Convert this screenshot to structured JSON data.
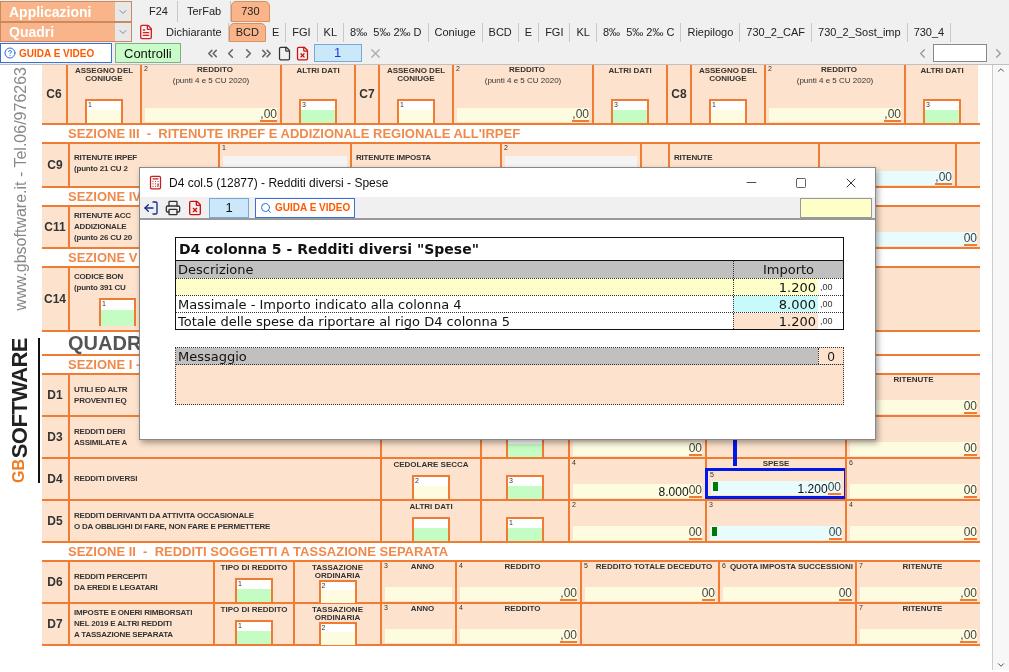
{
  "app_menu": {
    "label": "Applicazioni"
  },
  "section_menu": {
    "label": "Quadri"
  },
  "app_tabs": [
    {
      "label": "F24",
      "selected": false
    },
    {
      "label": "TerFab",
      "selected": false
    },
    {
      "label": "730",
      "selected": true
    }
  ],
  "quadri_tabs": [
    {
      "label": "Dichiarante",
      "selected": false
    },
    {
      "label": "BCD",
      "selected": true
    },
    {
      "label": "E",
      "selected": false
    },
    {
      "label": "FGI",
      "selected": false
    },
    {
      "label": "KL",
      "selected": false
    },
    {
      "label": "8‰  5‰ 2‰ D",
      "selected": false
    },
    {
      "label": "Coniuge",
      "selected": false
    },
    {
      "label": "BCD",
      "selected": false
    },
    {
      "label": "E",
      "selected": false
    },
    {
      "label": "FGI",
      "selected": false
    },
    {
      "label": "KL",
      "selected": false
    },
    {
      "label": "8‰  5‰ 2‰ C",
      "selected": false
    },
    {
      "label": "Riepilogo",
      "selected": false
    },
    {
      "label": "730_2_CAF",
      "selected": false
    },
    {
      "label": "730_2_Sost_imp",
      "selected": false
    },
    {
      "label": "730_4",
      "selected": false
    }
  ],
  "toolbar": {
    "help_button": "GUIDA E VIDEO",
    "controls_button": "Controlli",
    "page": "1"
  },
  "sidebar": {
    "website": "www.gbsoftware.it - Tel.06/976263",
    "logo_mark": "GB",
    "logo": "SOFTWARE"
  },
  "form": [
    {
      "kind": "c_groups",
      "groups": [
        {
          "code": "C6",
          "cells": [
            {
              "kind": "box",
              "num": "1",
              "label": "ASSEGNO DEL CONIUGE",
              "color": "#fdfbe0"
            },
            {
              "kind": "field",
              "num": "2",
              "label": "REDDITO",
              "sub": "(punti 4 e 5 CU 2020)",
              "cents": ",00",
              "color": "#fdfbe0"
            },
            {
              "kind": "box",
              "num": "3",
              "label": "ALTRI DATI",
              "color": "#c4fcc4"
            }
          ]
        },
        {
          "code": "C7",
          "cells": [
            {
              "kind": "box",
              "num": "1",
              "label": "ASSEGNO DEL CONIUGE",
              "color": "#fdfbe0"
            },
            {
              "kind": "field",
              "num": "2",
              "label": "REDDITO",
              "sub": "(punti 4 e 5 CU 2020)",
              "cents": ",00",
              "color": "#fdfbe0"
            },
            {
              "kind": "box",
              "num": "3",
              "label": "ALTRI DATI",
              "color": "#c4fcc4"
            }
          ]
        },
        {
          "code": "C8",
          "cells": [
            {
              "kind": "box",
              "num": "1",
              "label": "ASSEGNO DEL CONIUGE",
              "color": "#fdfbe0"
            },
            {
              "kind": "field",
              "num": "2",
              "label": "REDDITO",
              "sub": "(punti 4 e 5 CU 2020)",
              "cents": ",00",
              "color": "#fdfbe0"
            },
            {
              "kind": "box",
              "num": "3",
              "label": "ALTRI DATI",
              "color": "#c4fcc4"
            }
          ]
        }
      ]
    },
    {
      "kind": "section",
      "title": "SEZIONE III  -  RITENUTE IRPEF E ADDIZIONALE REGIONALE ALL'IRPEF"
    },
    {
      "kind": "c9",
      "code": "C9",
      "cells": [
        {
          "kind": "text",
          "lines": [
            "RITENUTE IRPEF",
            "(punto 21 CU 2"
          ]
        },
        {
          "kind": "field",
          "num": "1",
          "color": "#f4f4f4"
        },
        {
          "kind": "text",
          "lines": [
            "RITENUTE IMPOSTA"
          ]
        },
        {
          "kind": "field",
          "num": "2",
          "color": "#f4f4f4"
        },
        {
          "kind": "blank"
        },
        {
          "kind": "text",
          "lines": [
            "RITENUTE"
          ]
        },
        {
          "kind": "field",
          "cents": ",00",
          "color": "#e9fcfd"
        },
        {
          "kind": "blank"
        }
      ]
    },
    {
      "kind": "section",
      "title": "SEZIONE IV"
    },
    {
      "kind": "c_partial",
      "code": "C11",
      "cells": [
        {
          "kind": "text",
          "lines": [
            "RITENUTE ACC",
            "ADDIZIONALE",
            "(punto 26 CU 20"
          ]
        },
        {
          "kind": "field",
          "cents": "00",
          "color": "#e9fcfd"
        }
      ]
    },
    {
      "kind": "section",
      "title": "SEZIONE V"
    },
    {
      "kind": "c_partial",
      "code": "C14",
      "cells": [
        {
          "kind": "text",
          "lines": [
            "CODICE BON",
            "(punto 391 CU"
          ],
          "box_num": "1"
        },
        {
          "kind": "blank"
        }
      ]
    },
    {
      "kind": "title",
      "title": "QUADR"
    },
    {
      "kind": "section",
      "title": "SEZIONE I -"
    },
    {
      "kind": "d",
      "code": "D1",
      "cells": [
        {
          "kind": "text",
          "lines": [
            "UTILI ED ALTR",
            "PROVENTI EQ"
          ]
        },
        {
          "kind": "field",
          "label": "RITENUTE",
          "cents": "00",
          "color": "#fdfbe0"
        }
      ]
    },
    {
      "kind": "d",
      "code": "D3",
      "cells": [
        {
          "kind": "text",
          "lines": [
            "REDDITI DERI",
            "ASSIMILATE A"
          ]
        },
        {
          "kind": "blank"
        },
        {
          "kind": "box",
          "color": "#c4fcc4"
        },
        {
          "kind": "field",
          "cents": "00",
          "color": "#fdfbe0"
        },
        {
          "kind": "blank"
        },
        {
          "kind": "field",
          "cents": "00",
          "color": "#fdfbe0"
        }
      ]
    },
    {
      "kind": "d",
      "code": "D4",
      "cells": [
        {
          "kind": "text",
          "lines": [
            "REDDITI DIVERSI"
          ]
        },
        {
          "kind": "box",
          "num": "2",
          "label": "CEDOLARE SECCA",
          "color": "#fdfbe0"
        },
        {
          "kind": "box",
          "num": "3",
          "color": "#c4fcc4"
        },
        {
          "kind": "field",
          "num": "4",
          "value": "8.000",
          "cents": "00",
          "color": "#fdfbe0"
        },
        {
          "kind": "field",
          "num": "5",
          "label": "SPESE",
          "value": "1.200",
          "cents": "00",
          "color": "#e9fcfd",
          "marker": true,
          "highlighted": true
        },
        {
          "kind": "field",
          "num": "6",
          "cents": "00",
          "color": "#fdfbe0"
        }
      ]
    },
    {
      "kind": "d",
      "code": "D5",
      "cells": [
        {
          "kind": "text",
          "lines": [
            "REDDITI DERIVANTI DA ATTIVITA OCCASIONALE",
            "O DA OBBLIGHI DI FARE, NON FARE E PERMETTERE"
          ]
        },
        {
          "kind": "box",
          "label": "ALTRI DATI",
          "color": "#c4fcc4"
        },
        {
          "kind": "box",
          "num": "1",
          "color": "#c4fcc4"
        },
        {
          "kind": "field",
          "num": "2",
          "cents": "00",
          "color": "#fdfbe0"
        },
        {
          "kind": "field",
          "num": "3",
          "cents": "00",
          "color": "#e9fcfd",
          "marker": true
        },
        {
          "kind": "field",
          "num": "4",
          "cents": "00",
          "color": "#fdfbe0"
        }
      ]
    },
    {
      "kind": "section",
      "title": "SEZIONE II  -  REDDITI SOGGETTI A TASSAZIONE SEPARATA"
    },
    {
      "kind": "d_sep",
      "code": "D6",
      "cells": [
        {
          "kind": "text",
          "lines": [
            "REDDITI PERCEPITI",
            "DA EREDI E LEGATARI"
          ]
        },
        {
          "kind": "box",
          "num": "1",
          "label": "TIPO DI REDDITO",
          "color": "#c4fcc4"
        },
        {
          "kind": "box",
          "num": "2",
          "label": "TASSAZIONE ORDINARIA",
          "color": "#fdfbe0"
        },
        {
          "kind": "field",
          "num": "3",
          "label": "ANNO",
          "color": "#fdfbe0"
        },
        {
          "kind": "field",
          "num": "4",
          "label": "REDDITO",
          "cents": ",00",
          "color": "#fdfbe0"
        },
        {
          "kind": "field",
          "num": "5",
          "label": "REDDITO TOTALE DECEDUTO",
          "cents": "00",
          "color": "#fdfbe0"
        },
        {
          "kind": "field",
          "num": "6",
          "label": "QUOTA IMPOSTA SUCCESSIONI",
          "cents": "00",
          "color": "#fdfbe0"
        },
        {
          "kind": "field",
          "num": "7",
          "label": "RITENUTE",
          "cents": ",00",
          "color": "#fdfbe0"
        }
      ]
    },
    {
      "kind": "d_sep",
      "code": "D7",
      "cells": [
        {
          "kind": "text",
          "lines": [
            "IMPOSTE E ONERI RIMBORSATI",
            "NEL 2019 E ALTRI REDDITI",
            "A TASSAZIONE SEPARATA"
          ]
        },
        {
          "kind": "box",
          "num": "1",
          "label": "TIPO DI REDDITO",
          "color": "#c4fcc4"
        },
        {
          "kind": "box",
          "num": "2",
          "label": "TASSAZIONE ORDINARIA",
          "color": "#fdfbe0"
        },
        {
          "kind": "field",
          "num": "3",
          "label": "ANNO",
          "color": "#fdfbe0"
        },
        {
          "kind": "field",
          "num": "4",
          "label": "REDDITO",
          "cents": ",00",
          "color": "#fdfbe0"
        },
        {
          "kind": "merged"
        },
        {
          "kind": "field",
          "num": "7",
          "label": "RITENUTE",
          "cents": ",00",
          "color": "#fdfbe0"
        }
      ]
    }
  ],
  "dialog": {
    "title": "D4 col.5 (12877) - Redditi diversi - Spese",
    "page": "1",
    "help_button": "GUIDA E VIDEO",
    "table": {
      "title": "D4 colonna 5 - Redditi diversi \"Spese\"",
      "columns": [
        "Descrizione",
        "Importo"
      ],
      "rows": [
        {
          "kind": "input",
          "amount": "1.200",
          "cents": ",00"
        },
        {
          "kind": "reference",
          "description": "Massimale - Importo indicato alla colonna 4",
          "amount": "8.000",
          "cents": ",00"
        },
        {
          "kind": "total",
          "description": "Totale delle spese da riportare al rigo D4 colonna 5",
          "amount": "1.200",
          "cents": ",00"
        }
      ]
    },
    "message": {
      "label": "Messaggio",
      "count": "0"
    }
  }
}
